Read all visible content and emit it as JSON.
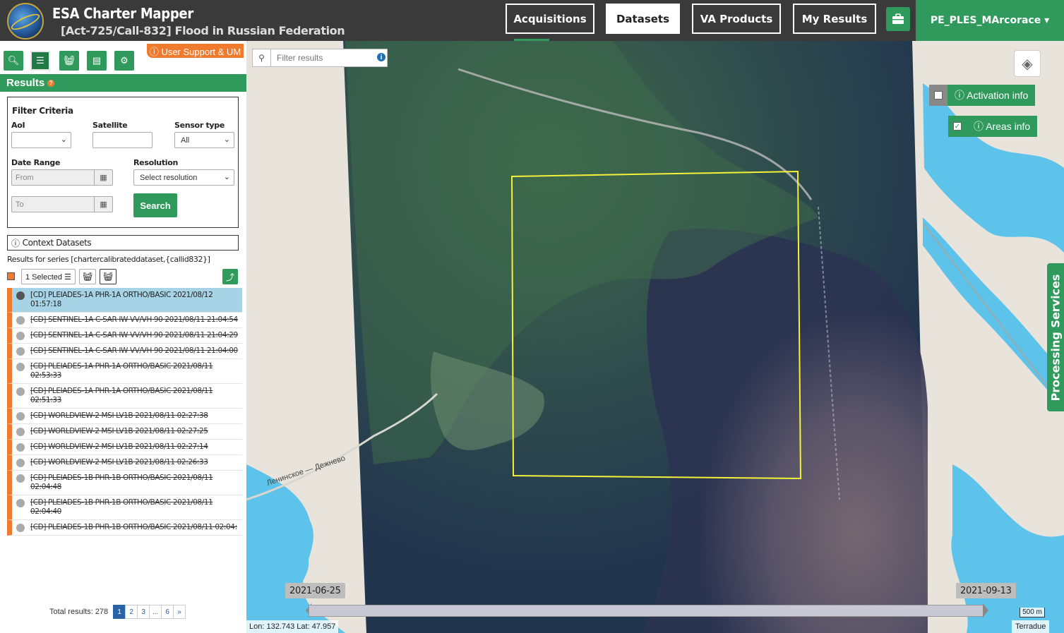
{
  "header": {
    "app_title": "ESA Charter Mapper",
    "activation_title": "[Act-725/Call-832] Flood in Russian Federation",
    "nav": [
      "Acquisitions",
      "Datasets",
      "VA Products",
      "My Results"
    ],
    "active_nav": "Datasets",
    "user": "PE_PLES_MArcorace ▾"
  },
  "left": {
    "support_label": "ⓘ User Support & UM",
    "results_label": "Results",
    "filter": {
      "title": "Filter Criteria",
      "aoi_label": "AoI",
      "satellite_label": "Satellite",
      "sensor_label": "Sensor type",
      "sensor_value": "All",
      "date_range_label": "Date Range",
      "from_placeholder": "From",
      "to_placeholder": "To",
      "resolution_label": "Resolution",
      "resolution_value": "Select resolution",
      "search_label": "Search"
    },
    "context_label": "Context Datasets",
    "series_text": "Results for series [chartercalibrateddataset,{callid832}]",
    "selected_label": "1 Selected ☰",
    "results": [
      {
        "label": "[CD] PLEIADES-1A PHR-1A ORTHO/BASIC 2021/08/12 01:57:18",
        "selected": true,
        "struck": false
      },
      {
        "label": "[CD] SENTINEL-1A C-SAR IW VV/VH 90 2021/08/11 21:04:54",
        "selected": false,
        "struck": true
      },
      {
        "label": "[CD] SENTINEL-1A C-SAR IW VV/VH 90 2021/08/11 21:04:29",
        "selected": false,
        "struck": true
      },
      {
        "label": "[CD] SENTINEL-1A C-SAR IW VV/VH 90 2021/08/11 21:04:00",
        "selected": false,
        "struck": true
      },
      {
        "label": "[CD] PLEIADES-1A PHR-1A ORTHO/BASIC 2021/08/11 02:53:33",
        "selected": false,
        "struck": true
      },
      {
        "label": "[CD] PLEIADES-1A PHR-1A ORTHO/BASIC 2021/08/11 02:51:33",
        "selected": false,
        "struck": true
      },
      {
        "label": "[CD] WORLDVIEW-2 MSI LV1B 2021/08/11 02:27:38",
        "selected": false,
        "struck": true
      },
      {
        "label": "[CD] WORLDVIEW-2 MSI LV1B 2021/08/11 02:27:25",
        "selected": false,
        "struck": true
      },
      {
        "label": "[CD] WORLDVIEW-2 MSI LV1B 2021/08/11 02:27:14",
        "selected": false,
        "struck": true
      },
      {
        "label": "[CD] WORLDVIEW-2 MSI LV1B 2021/08/11 02:26:33",
        "selected": false,
        "struck": true
      },
      {
        "label": "[CD] PLEIADES-1B PHR-1B ORTHO/BASIC 2021/08/11 02:04:48",
        "selected": false,
        "struck": true
      },
      {
        "label": "[CD] PLEIADES-1B PHR-1B ORTHO/BASIC 2021/08/11 02:04:40",
        "selected": false,
        "struck": true
      },
      {
        "label": "[CD] PLEIADES-1B PHR-1B ORTHO/BASIC 2021/08/11 02:04:",
        "selected": false,
        "struck": true
      }
    ],
    "total_results": "Total results: 278",
    "pages": [
      "1",
      "2",
      "3",
      "...",
      "6",
      "»"
    ],
    "active_page": "1"
  },
  "map": {
    "filter_placeholder": "Filter results",
    "activation_info_label": "ⓘ Activation info",
    "areas_info_label": "ⓘ Areas info",
    "areas_info_checked": true,
    "activation_info_checked": false,
    "processing_label": "Processing Services",
    "timeline_start": "2021-06-25",
    "timeline_end": "2021-09-13",
    "scale_label": "500 m",
    "coords": "Lon: 132.743 Lat: 47.957",
    "attribution": "Terradue",
    "road_label": "Ленинское — Дежнево",
    "colors": {
      "water": "#5ec3ea",
      "aoi": "#f4f23a",
      "accent": "#2f9a5c",
      "orange": "#f07a2e"
    }
  }
}
